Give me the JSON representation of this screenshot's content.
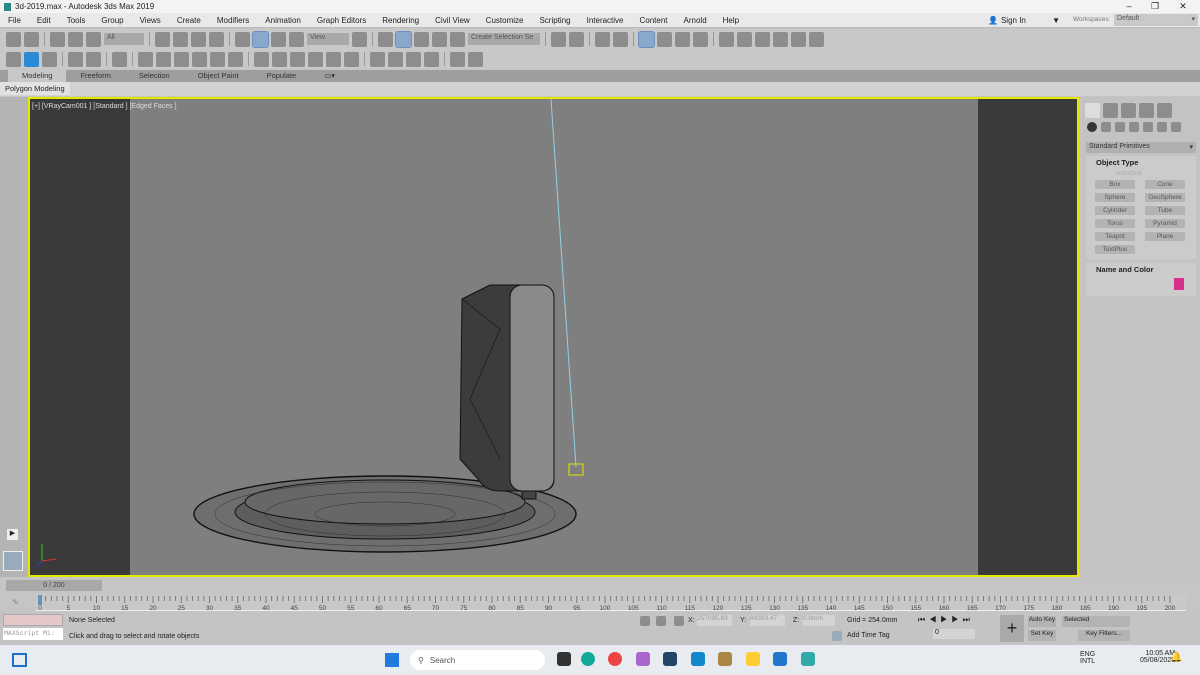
{
  "window": {
    "title": "3d-2019.max - Autodesk 3ds Max 2019",
    "minimize": "–",
    "maximize": "❐",
    "close": "✕"
  },
  "menu": [
    "File",
    "Edit",
    "Tools",
    "Group",
    "Views",
    "Create",
    "Modifiers",
    "Animation",
    "Graph Editors",
    "Rendering",
    "Civil View",
    "Customize",
    "Scripting",
    "Interactive",
    "Content",
    "Arnold",
    "Help"
  ],
  "account": {
    "sign_in": "Sign In",
    "workspaces_label": "Workspaces:",
    "workspace": "Default"
  },
  "toolbar": {
    "filter": "All",
    "ref_coord": "View",
    "named_selection": "Create Selection Se"
  },
  "toolbar1_icons": [
    "undo-icon",
    "redo-icon",
    "link-icon",
    "unlink-icon",
    "bind-spacewarp-icon",
    "select-object-icon",
    "select-by-name-icon",
    "rect-selection-icon",
    "window-crossing-icon",
    "move-icon",
    "rotate-icon",
    "scale-icon",
    "placement-icon",
    "pivot-icon",
    "snap-3d-icon",
    "angle-snap-icon",
    "percent-snap-icon",
    "spinner-snap-icon",
    "edit-named-sets-icon",
    "mirror-icon",
    "align-icon",
    "layer-explorer-icon",
    "scene-explorer-icon",
    "graphite-icon",
    "curve-editor-icon",
    "dope-sheet-icon",
    "schematic-icon",
    "material-editor-icon",
    "render-setup-icon",
    "render-frame-icon",
    "render-icon",
    "render-iterative-icon",
    "viewport-layout-icon"
  ],
  "toolbar2_icons": [
    "teapot-icon",
    "autodesk-icon",
    "media-icon",
    "light-lister-icon",
    "scene-states-icon",
    "camera-icon",
    "box-icon",
    "sphere-icon",
    "torus-icon",
    "teapot-prim-icon",
    "cone-icon",
    "sun-icon",
    "plane-icon",
    "net-icon",
    "shade-icon",
    "pyramid-icon",
    "geosphere-icon",
    "cactus-icon",
    "globe-icon",
    "color-dots-icon",
    "vray-icon",
    "vray-render-icon",
    "frame-buffer-icon",
    "help-icon"
  ],
  "ribbon": {
    "tabs": [
      "Modeling",
      "Freeform",
      "Selection",
      "Object Paint",
      "Populate"
    ],
    "active": "Modeling",
    "sub": "Polygon Modeling"
  },
  "viewport": {
    "label": "[+] [VRayCam001 ] [Standard ] [Edged Faces ]"
  },
  "command_panel": {
    "category": "Standard Primitives",
    "object_type_title": "Object Type",
    "autogrid": "AutoGrid",
    "buttons": [
      "Box",
      "Cone",
      "Sphere",
      "GeoSphere",
      "Cylinder",
      "Tube",
      "Torus",
      "Pyramid",
      "Teapot",
      "Plane",
      "TextPlus"
    ],
    "name_color_title": "Name and Color",
    "color": "#d6308a"
  },
  "timeline": {
    "position": "0 / 200",
    "start": 0,
    "end": 200,
    "step": 5
  },
  "status": {
    "selection": "None Selected",
    "prompt": "Click and drag to select and rotate objects",
    "maxscript": "MAXScript Mi:",
    "x_label": "X:",
    "x": "257095.83",
    "y_label": "Y:",
    "y": "84393.47",
    "z_label": "Z:",
    "z": "0.0mm",
    "grid": "Grid = 254.0mm",
    "add_time_tag": "Add Time Tag",
    "frame": "0",
    "auto_key": "Auto Key",
    "set_key": "Set Key",
    "key_mode": "Selected",
    "key_filters": "Key Filters..."
  },
  "taskbar": {
    "search": "Search",
    "lang1": "ENG",
    "lang2": "INTL",
    "time": "10:05 AM",
    "date": "05/08/2025"
  }
}
